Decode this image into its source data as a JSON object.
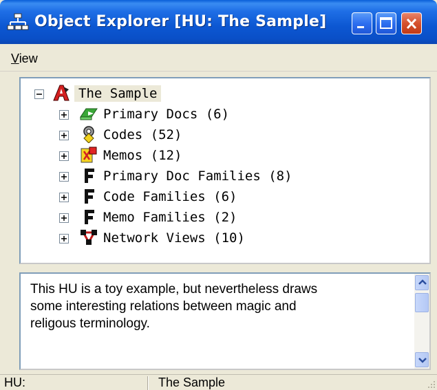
{
  "window": {
    "title": "Object Explorer  [HU: The Sample]"
  },
  "icons": {
    "app": "object-explorer-icon",
    "minimize": "minimize-icon",
    "maximize": "maximize-icon",
    "close": "close-icon",
    "root": "hermeneutic-unit-icon",
    "primary_docs": "primary-docs-icon",
    "codes": "codes-icon",
    "memos": "memos-icon",
    "families": "family-icon",
    "network_views": "network-views-icon"
  },
  "menubar": {
    "view_accel": "V",
    "view_rest": "iew"
  },
  "tree": {
    "root": {
      "label": "The Sample"
    },
    "items": [
      {
        "label": "Primary Docs (6)"
      },
      {
        "label": "Codes (52)"
      },
      {
        "label": "Memos (12)"
      },
      {
        "label": "Primary Doc Families (8)"
      },
      {
        "label": "Code Families (6)"
      },
      {
        "label": "Memo Families (2)"
      },
      {
        "label": "Network Views (10)"
      }
    ]
  },
  "comment": {
    "line1": "This HU is a toy example, but nevertheless draws",
    "line2": "some interesting relations between magic and",
    "line3": "religous terminology."
  },
  "statusbar": {
    "label": "HU:",
    "value": "The Sample"
  },
  "colors": {
    "titlebar_blue": "#0c57d2",
    "close_red": "#d5512e",
    "window_face": "#ece9d8",
    "selection_bg": "#ece9d8"
  }
}
